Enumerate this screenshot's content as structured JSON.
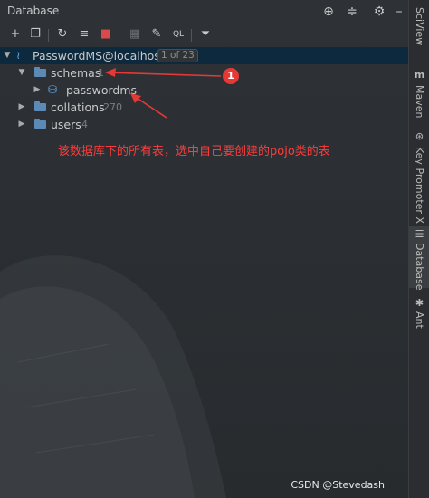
{
  "window": {
    "title": "Database"
  },
  "title_bar_icons": [
    "crosshair-icon",
    "collapse-all-icon",
    "gear-icon",
    "minimize-icon"
  ],
  "toolbar": {
    "icons": [
      "add-icon",
      "copy-icon",
      "refresh-icon",
      "edit-properties-icon",
      "stop-icon",
      "table-icon",
      "edit-icon",
      "console-icon",
      "filter-icon"
    ]
  },
  "tree": {
    "root": {
      "label": "PasswordMS@localhost",
      "badge": "1 of 23"
    },
    "schemas": {
      "label": "schemas",
      "count": "1"
    },
    "passwordms": {
      "label": "passwordms"
    },
    "collations": {
      "label": "collations",
      "count": "270"
    },
    "users": {
      "label": "users",
      "count": "4"
    }
  },
  "annotation": {
    "marker": "1",
    "text": "该数据库下的所有表，选中自己要创建的pojo类的表",
    "color": "#ff3b3b"
  },
  "right_sidebar": {
    "tabs": [
      {
        "label": "SciView",
        "icon": "sciview-icon"
      },
      {
        "label": "Maven",
        "icon": "maven-icon"
      },
      {
        "label": "Key Promoter X",
        "icon": "key-promoter-icon"
      },
      {
        "label": "Database",
        "icon": "database-icon",
        "active": true
      },
      {
        "label": "Ant",
        "icon": "ant-icon"
      }
    ]
  },
  "watermark": "CSDN @Stevedash"
}
